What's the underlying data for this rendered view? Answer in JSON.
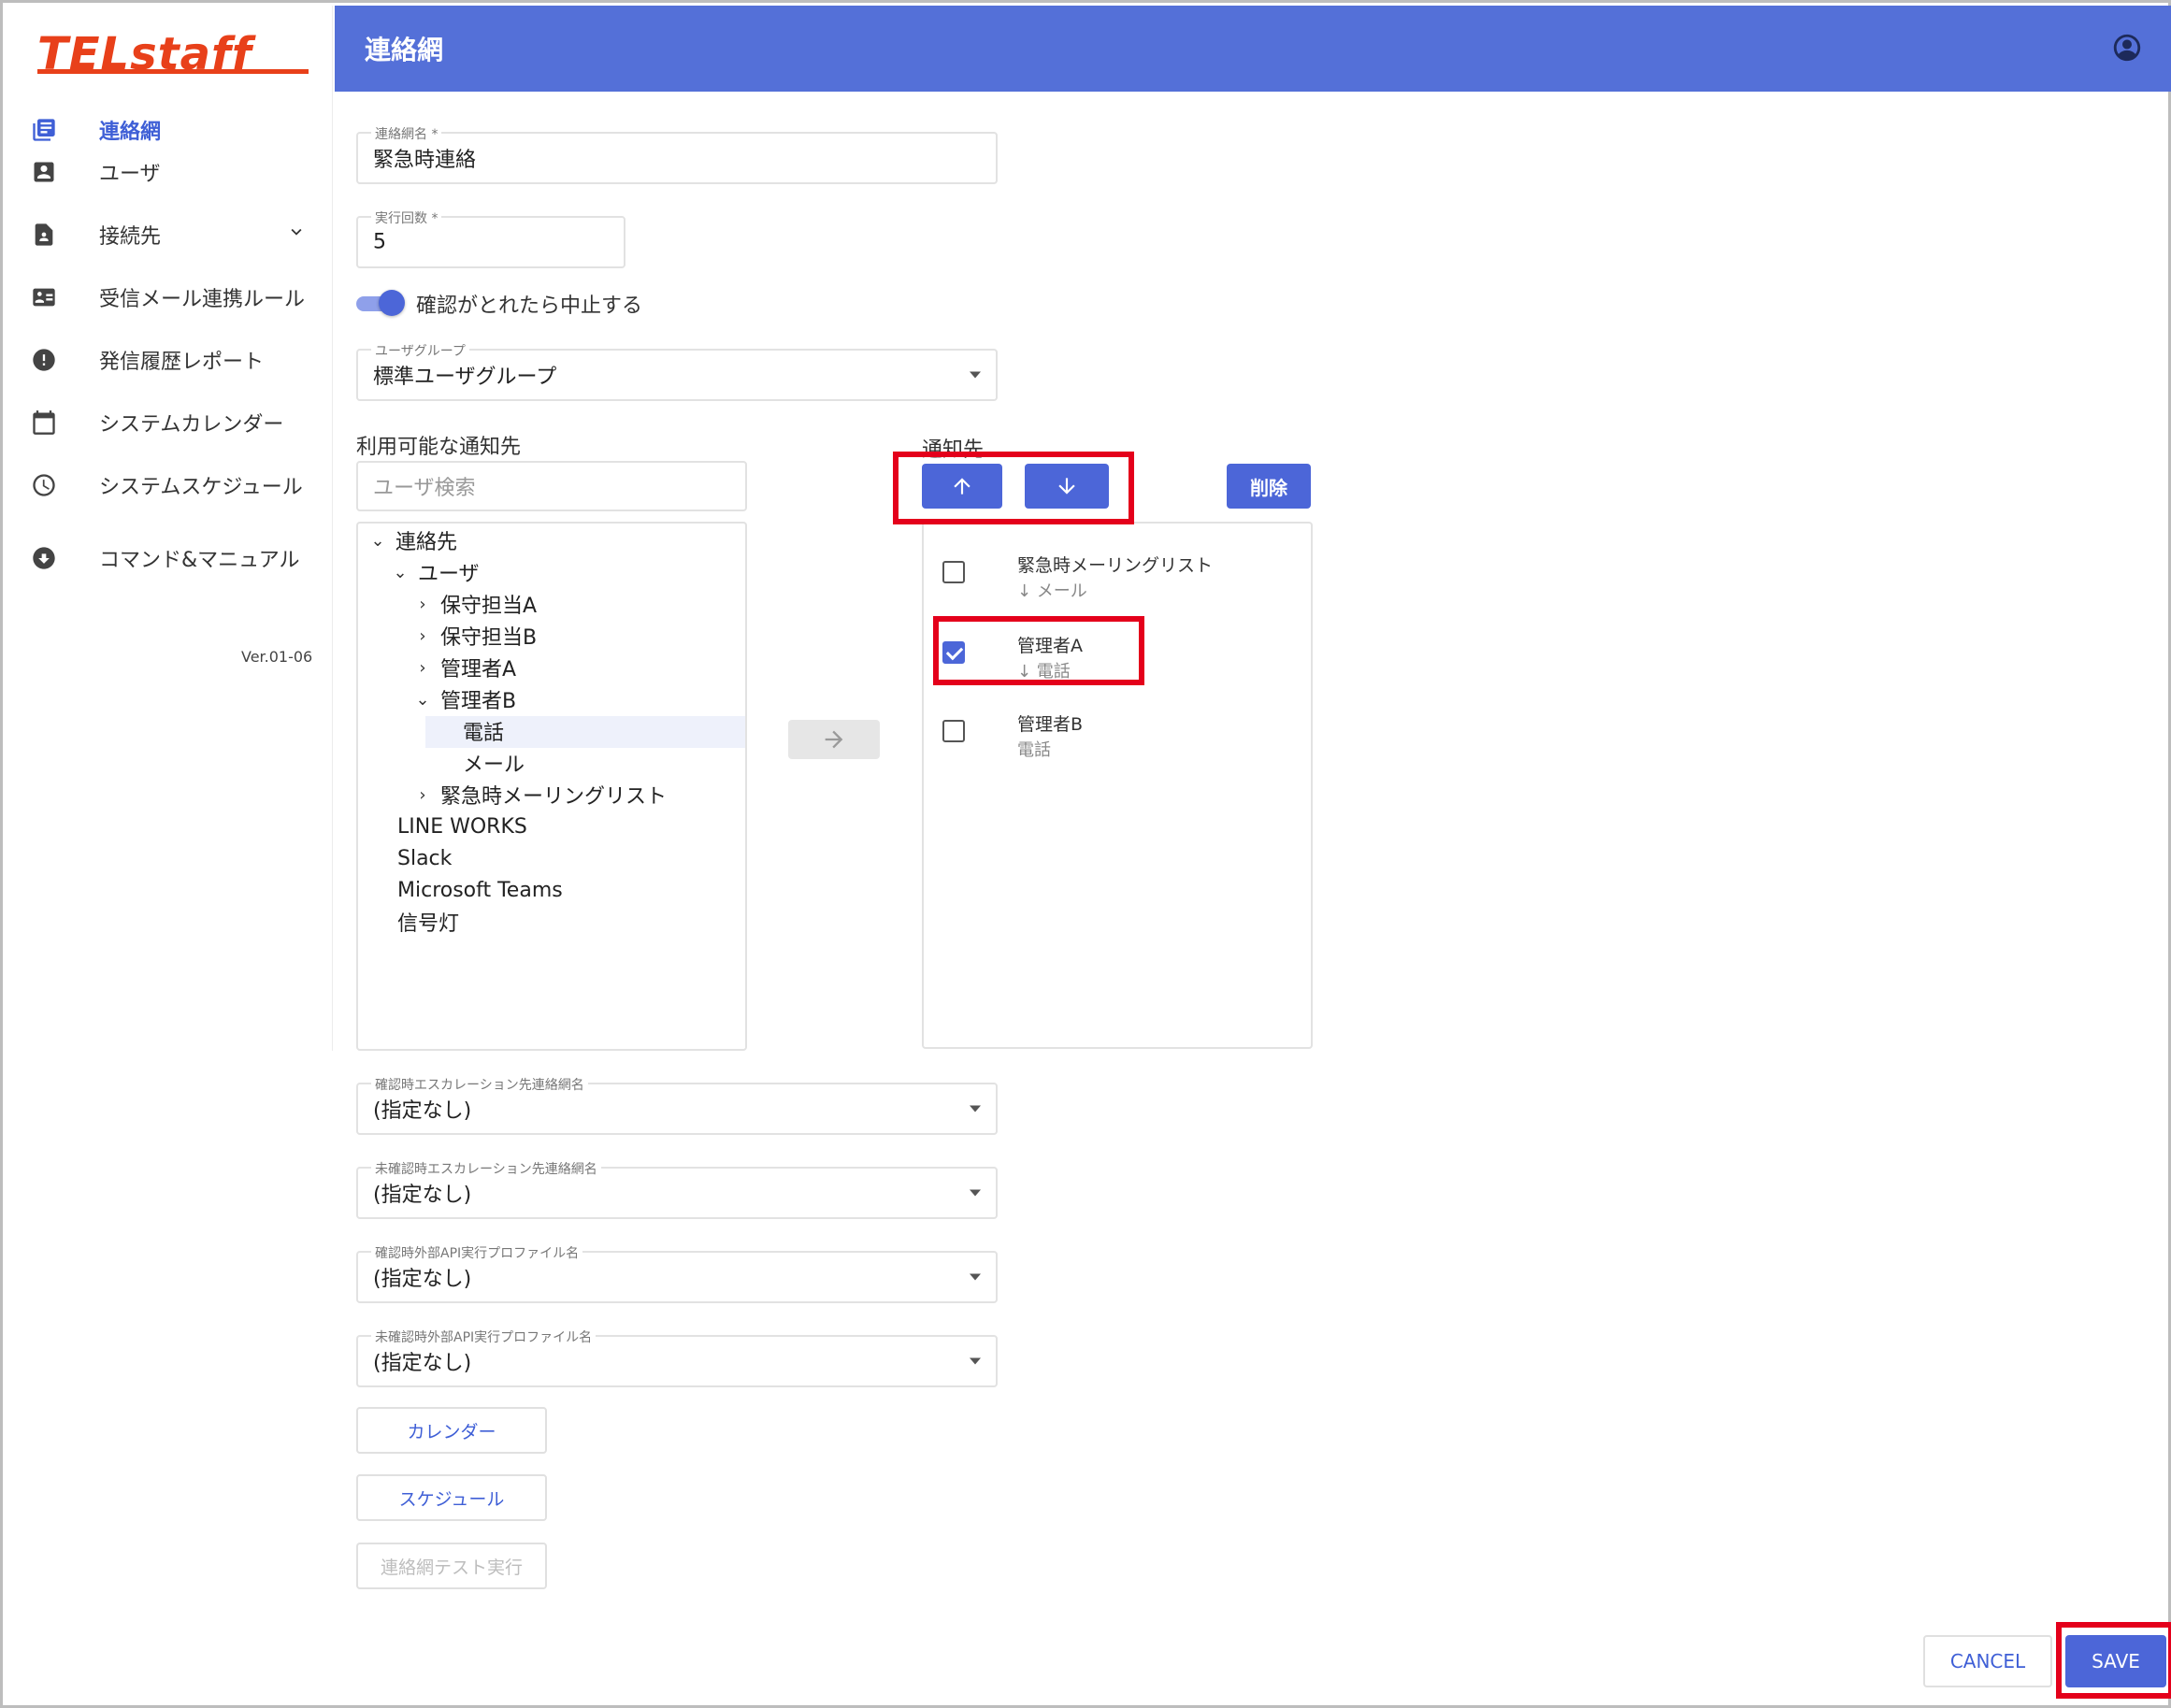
{
  "app": {
    "logo_text": "TELstaff",
    "header_title": "連絡網",
    "version": "Ver.01-06"
  },
  "sidebar": {
    "items": [
      {
        "label": "連絡網",
        "icon": "list-icon",
        "active": true
      },
      {
        "label": "ユーザ",
        "icon": "user-card-icon"
      },
      {
        "label": "接続先",
        "icon": "document-person-icon",
        "expandable": true
      },
      {
        "label": "受信メール連携ルール",
        "icon": "id-card-icon"
      },
      {
        "label": "発信履歴レポート",
        "icon": "alert-circle-icon"
      },
      {
        "label": "システムカレンダー",
        "icon": "calendar-icon"
      },
      {
        "label": "システムスケジュール",
        "icon": "clock-icon"
      },
      {
        "label": "コマンド&マニュアル",
        "icon": "download-circle-icon"
      }
    ]
  },
  "form": {
    "name": {
      "label": "連絡網名 *",
      "value": "緊急時連絡"
    },
    "count": {
      "label": "実行回数 *",
      "value": "5"
    },
    "stop_toggle": {
      "label": "確認がとれたら中止する",
      "on": true
    },
    "user_group": {
      "label": "ユーザグループ",
      "value": "標準ユーザグループ"
    },
    "available_title": "利用可能な通知先",
    "search_placeholder": "ユーザ検索",
    "notify_title": "通知先",
    "delete_label": "削除",
    "confirmed_escalation": {
      "label": "確認時エスカレーション先連絡網名",
      "value": "(指定なし)"
    },
    "unconfirmed_escalation": {
      "label": "未確認時エスカレーション先連絡網名",
      "value": "(指定なし)"
    },
    "confirmed_api": {
      "label": "確認時外部API実行プロファイル名",
      "value": "(指定なし)"
    },
    "unconfirmed_api": {
      "label": "未確認時外部API実行プロファイル名",
      "value": "(指定なし)"
    },
    "calendar_button": "カレンダー",
    "schedule_button": "スケジュール",
    "test_button": "連絡網テスト実行",
    "cancel_button": "CANCEL",
    "save_button": "SAVE"
  },
  "tree": {
    "root": "連絡先",
    "users": "ユーザ",
    "user_a": "保守担当A",
    "user_b": "保守担当B",
    "admin_a": "管理者A",
    "admin_b": "管理者B",
    "phone": "電話",
    "mail": "メール",
    "mailing_list": "緊急時メーリングリスト",
    "line_works": "LINE WORKS",
    "slack": "Slack",
    "teams": "Microsoft Teams",
    "signal": "信号灯"
  },
  "notify_list": [
    {
      "name": "緊急時メーリングリスト",
      "sub": "↓ メール",
      "checked": false
    },
    {
      "name": "管理者A",
      "sub": "↓ 電話",
      "checked": true
    },
    {
      "name": "管理者B",
      "sub": "電話",
      "checked": false
    }
  ],
  "colors": {
    "header": "#5470d8",
    "primary": "#4c66d8",
    "highlight_box": "#e4001b",
    "logo": "#e8401a"
  }
}
